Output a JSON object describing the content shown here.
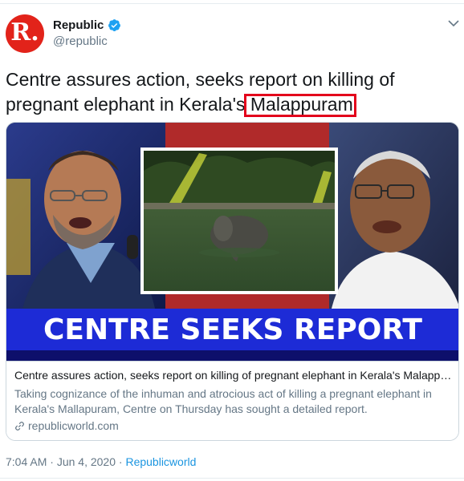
{
  "account": {
    "display_name": "Republic",
    "handle": "@republic",
    "avatar_letter": "R.",
    "verified": true,
    "brand_color": "#e2231a"
  },
  "tweet": {
    "text_before": "Centre assures action, seeks report on killing of pregnant elephant in Kerala's ",
    "text_highlight": "Malappuram",
    "highlight_color": "#e3001b"
  },
  "card": {
    "banner_text": "CENTRE SEEKS REPORT",
    "title": "Centre assures action, seeks report on killing of pregnant elephant in Kerala's Malappuram",
    "description": "Taking cognizance of the inhuman and atrocious act of killing a pregnant elephant in Kerala's Mallapuram, Centre on Thursday has sought a detailed report.",
    "domain": "republicworld.com",
    "banner_color": "#1d2bd6"
  },
  "meta": {
    "time": "7:04 AM",
    "separator": " · ",
    "date": "Jun 4, 2020",
    "source": "Republicworld"
  },
  "icons": {
    "verified": "verified-badge-icon",
    "caret": "chevron-down-icon",
    "link": "link-icon"
  }
}
